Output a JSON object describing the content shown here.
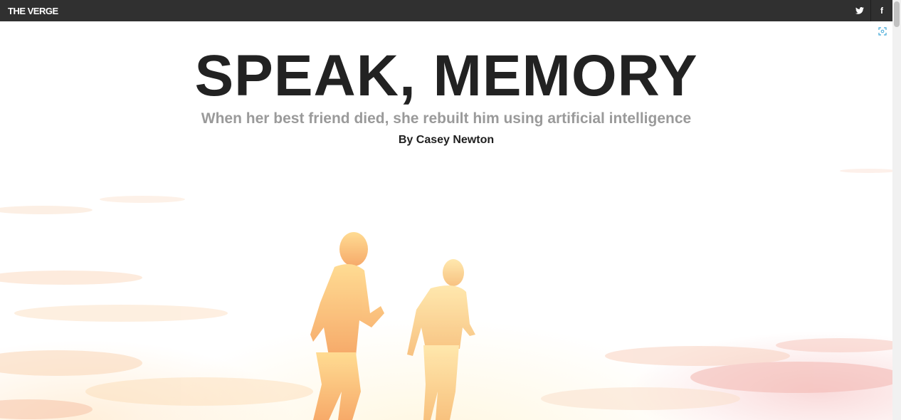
{
  "header": {
    "logo_text": "THE VERGE",
    "social": [
      {
        "icon": "twitter-icon",
        "glyph": "🐦"
      },
      {
        "icon": "facebook-icon",
        "glyph": "f"
      }
    ]
  },
  "article": {
    "headline": "SPEAK, MEMORY",
    "subhead": "When her best friend died, she rebuilt him using artificial intelligence",
    "byline": "By Casey Newton"
  },
  "hero": {
    "image_icon": "expand-icon"
  },
  "colors": {
    "topbar": "#303030",
    "headline": "#222222",
    "subhead": "#9a9a9a",
    "accent": "#3fa7d6"
  }
}
